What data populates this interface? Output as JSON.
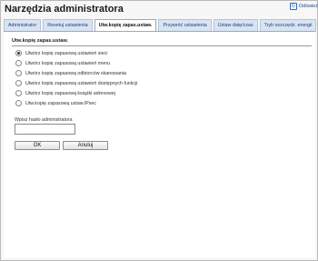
{
  "header": {
    "title": "Narzędzia administratora",
    "refresh_label": "Odświeź"
  },
  "tabs": [
    {
      "label": "Administrator",
      "active": false
    },
    {
      "label": "Resetuj ustawienia",
      "active": false
    },
    {
      "label": "Utw.kopię zapas.ustaw.",
      "active": true
    },
    {
      "label": "Przywróć ustawienia",
      "active": false
    },
    {
      "label": "Ustaw datę/czas",
      "active": false
    },
    {
      "label": "Tryb oszczędz. energii",
      "active": false
    }
  ],
  "section": {
    "title": "Utw.kopię zapas.ustaw."
  },
  "options": [
    {
      "label": "Utwórz kopię zapasową ustawień sieci",
      "checked": true
    },
    {
      "label": "Utwórz kopię zapasową ustawień menu",
      "checked": false
    },
    {
      "label": "Utwórz kopię zapasową odbiorców skanowania",
      "checked": false
    },
    {
      "label": "Utwórz kopię zapasową ustawień dostępnych funkcji",
      "checked": false
    },
    {
      "label": "Utwórz kopię zapasową książki adresowej",
      "checked": false
    },
    {
      "label": "Utw.kopię zapasową ustaw.IPsec",
      "checked": false
    }
  ],
  "password": {
    "label": "Wpisz hasło administratora",
    "value": ""
  },
  "buttons": {
    "ok": "OK",
    "cancel": "Anuluj"
  },
  "colors": {
    "tab_background": "#d9e4f3",
    "tab_text": "#1f3f7a",
    "active_tab": "#ffffff"
  }
}
